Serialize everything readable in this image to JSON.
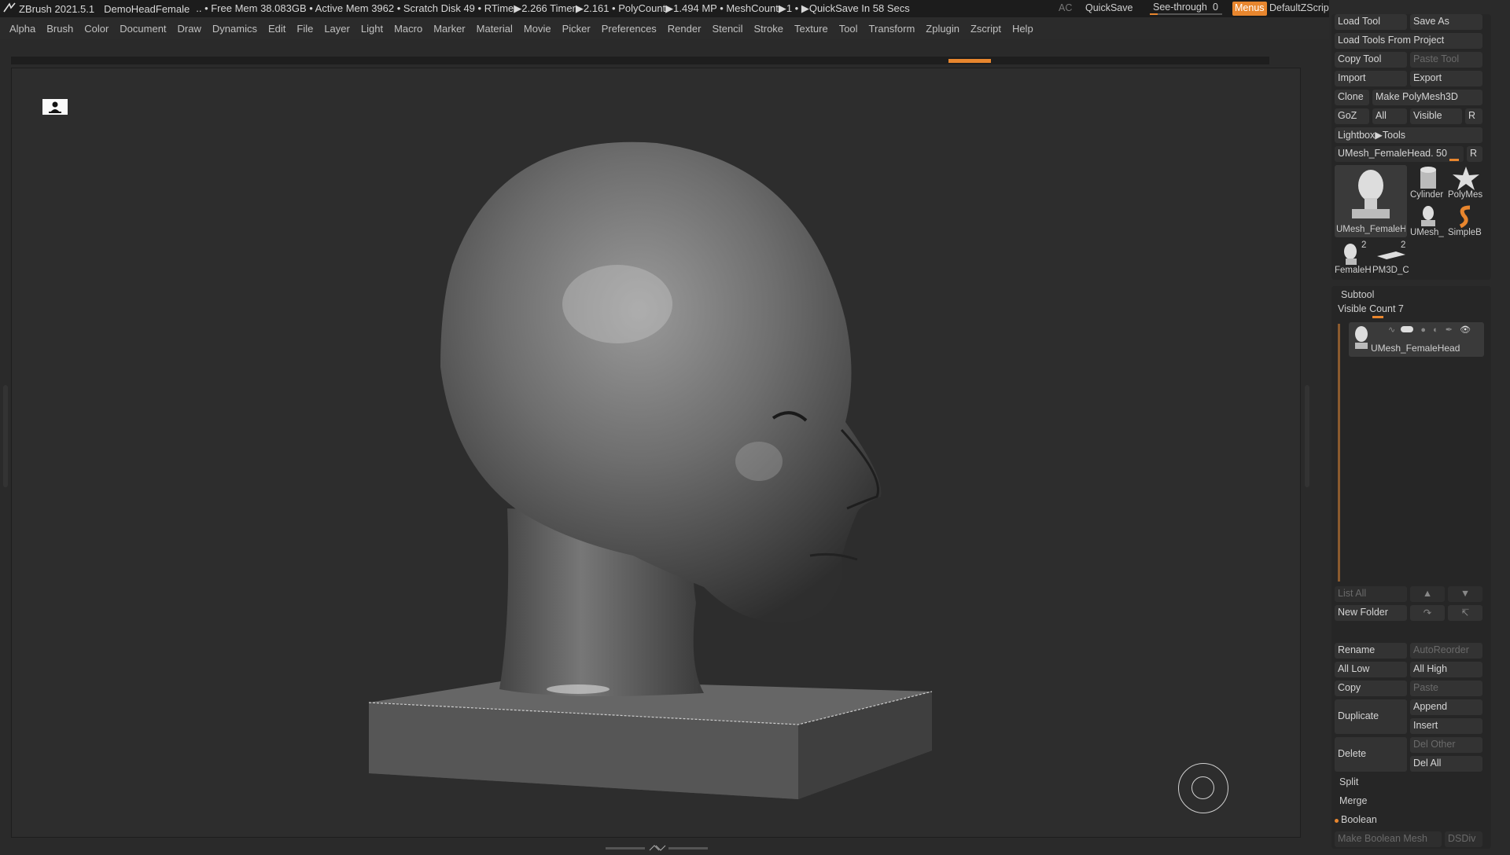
{
  "titlebar": {
    "app": "ZBrush 2021.5.1",
    "document": "DemoHeadFemale",
    "stats": ".. • Free Mem 38.083GB • Active Mem 3962 • Scratch Disk 49 • RTime▶2.266 Timer▶2.161 • PolyCount▶1.494 MP • MeshCount▶1 • ▶QuickSave In 58 Secs",
    "ac": "AC",
    "quicksave": "QuickSave",
    "see_through_label": "See-through",
    "see_through_value": "0",
    "menus": "Menus",
    "zscript": "DefaultZScript"
  },
  "menubar": [
    "Alpha",
    "Brush",
    "Color",
    "Document",
    "Draw",
    "Dynamics",
    "Edit",
    "File",
    "Layer",
    "Light",
    "Macro",
    "Marker",
    "Material",
    "Movie",
    "Picker",
    "Preferences",
    "Render",
    "Stencil",
    "Stroke",
    "Texture",
    "Tool",
    "Transform",
    "Zplugin",
    "Zscript",
    "Help"
  ],
  "tool": {
    "load_tool": "Load Tool",
    "save_as": "Save As",
    "load_from_project": "Load Tools From Project",
    "copy_tool": "Copy Tool",
    "paste_tool": "Paste Tool",
    "import": "Import",
    "export": "Export",
    "clone": "Clone",
    "make_polymesh": "Make PolyMesh3D",
    "goz": "GoZ",
    "all": "All",
    "visible": "Visible",
    "r": "R",
    "lightbox": "Lightbox▶Tools",
    "current_tool": "UMesh_FemaleHead. 50",
    "thumbs": {
      "main": "UMesh_FemaleH",
      "cylinder": "Cylinder",
      "polymesh": "PolyMes",
      "umesh_small": "UMesh_",
      "simpleb": "SimpleB",
      "femaleh": "FemaleH",
      "pm3d": "PM3D_C",
      "count_a": "2",
      "count_b": "2"
    }
  },
  "subtool": {
    "header": "Subtool",
    "visible_count": "Visible Count 7",
    "item_name": "UMesh_FemaleHead",
    "list_all": "List All",
    "new_folder": "New Folder",
    "rename": "Rename",
    "autoreorder": "AutoReorder",
    "all_low": "All Low",
    "all_high": "All High",
    "copy": "Copy",
    "paste": "Paste",
    "duplicate": "Duplicate",
    "append": "Append",
    "insert": "Insert",
    "delete": "Delete",
    "del_other": "Del Other",
    "del_all": "Del All",
    "split": "Split",
    "merge": "Merge",
    "boolean": "Boolean",
    "make_boolean_mesh": "Make Boolean Mesh",
    "dsdiv": "DSDiv"
  },
  "colors": {
    "accent": "#e8862e",
    "menus_button": "#e8862e"
  }
}
